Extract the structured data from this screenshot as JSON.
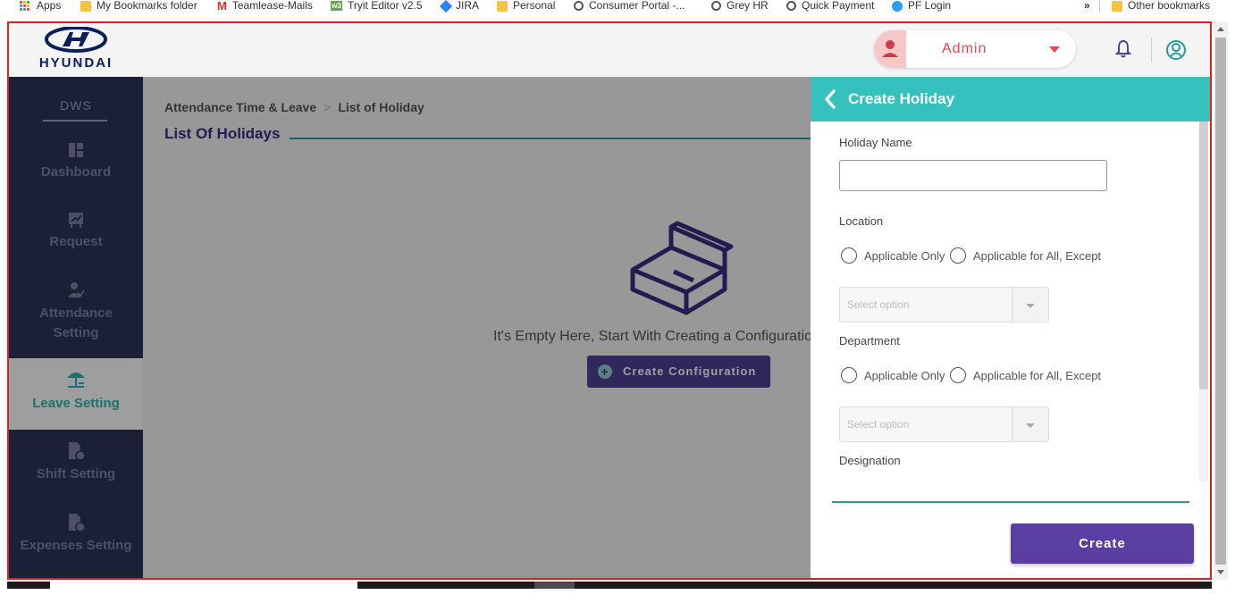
{
  "bookmarks": {
    "apps": "Apps",
    "items": [
      "My Bookmarks folder",
      "Teamlease-Mails",
      "Tryit Editor v2.5",
      "JIRA",
      "Personal",
      "Consumer Portal -...",
      "Grey HR",
      "Quick Payment",
      "PF Login"
    ],
    "overflow": "»",
    "other": "Other bookmarks"
  },
  "header": {
    "logo_text": "HYUNDAI",
    "user_role": "Admin"
  },
  "sidebar": {
    "section": "DWS",
    "items": [
      {
        "label": "Dashboard",
        "icon": "dashboard-icon"
      },
      {
        "label": "Request",
        "icon": "request-icon"
      },
      {
        "label": "Attendance Setting",
        "icon": "attendance-icon"
      },
      {
        "label": "Leave Setting",
        "icon": "beach-umbrella-icon",
        "active": true
      },
      {
        "label": "Shift Setting",
        "icon": "document-rupee-icon"
      },
      {
        "label": "Expenses Setting",
        "icon": "document-rupee-icon"
      }
    ]
  },
  "main": {
    "breadcrumb": [
      "Attendance Time & Leave",
      "List of Holiday"
    ],
    "title": "List Of Holidays",
    "empty_text": "It's Empty Here, Start With Creating a Configuration",
    "create_config_label": "Create Configuration"
  },
  "drawer": {
    "title": "Create Holiday",
    "holiday_name_label": "Holiday Name",
    "holiday_name_value": "",
    "location_label": "Location",
    "department_label": "Department",
    "designation_label": "Designation",
    "radio_only": "Applicable Only",
    "radio_all_except": "Applicable for All, Except",
    "select_placeholder": "Select option",
    "create_label": "Create"
  },
  "colors": {
    "accent_teal": "#35c1bd",
    "primary_purple": "#5a3ea1",
    "sidebar_bg": "#2e3458",
    "admin_red": "#e64553"
  }
}
